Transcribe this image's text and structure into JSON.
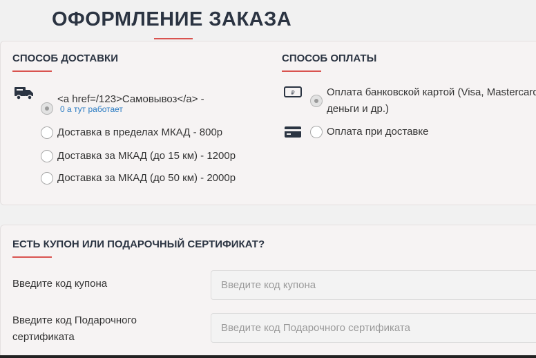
{
  "page": {
    "title": "ОФОРМЛЕНИЕ ЗАКАЗА"
  },
  "delivery": {
    "heading": "СПОСОБ ДОСТАВКИ",
    "options": [
      {
        "label": "<a href=/123>Самовывоз</a> -",
        "note": "0 а тут работает",
        "checked": true
      },
      {
        "label": "Доставка в пределах МКАД - 800р",
        "checked": false
      },
      {
        "label": "Доставка за МКАД (до 15 км) - 1200р",
        "checked": false
      },
      {
        "label": "Доставка за МКАД (до 50 км) - 2000р",
        "checked": false
      }
    ],
    "icon": "truck-icon"
  },
  "payment": {
    "heading": "СПОСОБ ОПЛАТЫ",
    "options": [
      {
        "label_line1": "Оплата банковской картой (Visa, Mastercard),",
        "label_line2": "деньги и др.)",
        "checked": true,
        "icon": "ruble-terminal-icon"
      },
      {
        "label": "Оплата при доставке",
        "checked": false,
        "icon": "credit-card-icon"
      }
    ]
  },
  "coupon": {
    "heading": "ЕСТЬ КУПОН ИЛИ ПОДАРОЧНЫЙ СЕРТИФИКАТ?",
    "coupon_label": "Введите код купона",
    "coupon_placeholder": "Введите код купона",
    "gift_label_line1": "Введите код Подарочного",
    "gift_label_line2": "сертификата",
    "gift_placeholder": "Введите код Подарочного сертификата"
  },
  "colors": {
    "accent": "#d9534f",
    "heading": "#2b3442",
    "link": "#2a7bc2"
  }
}
